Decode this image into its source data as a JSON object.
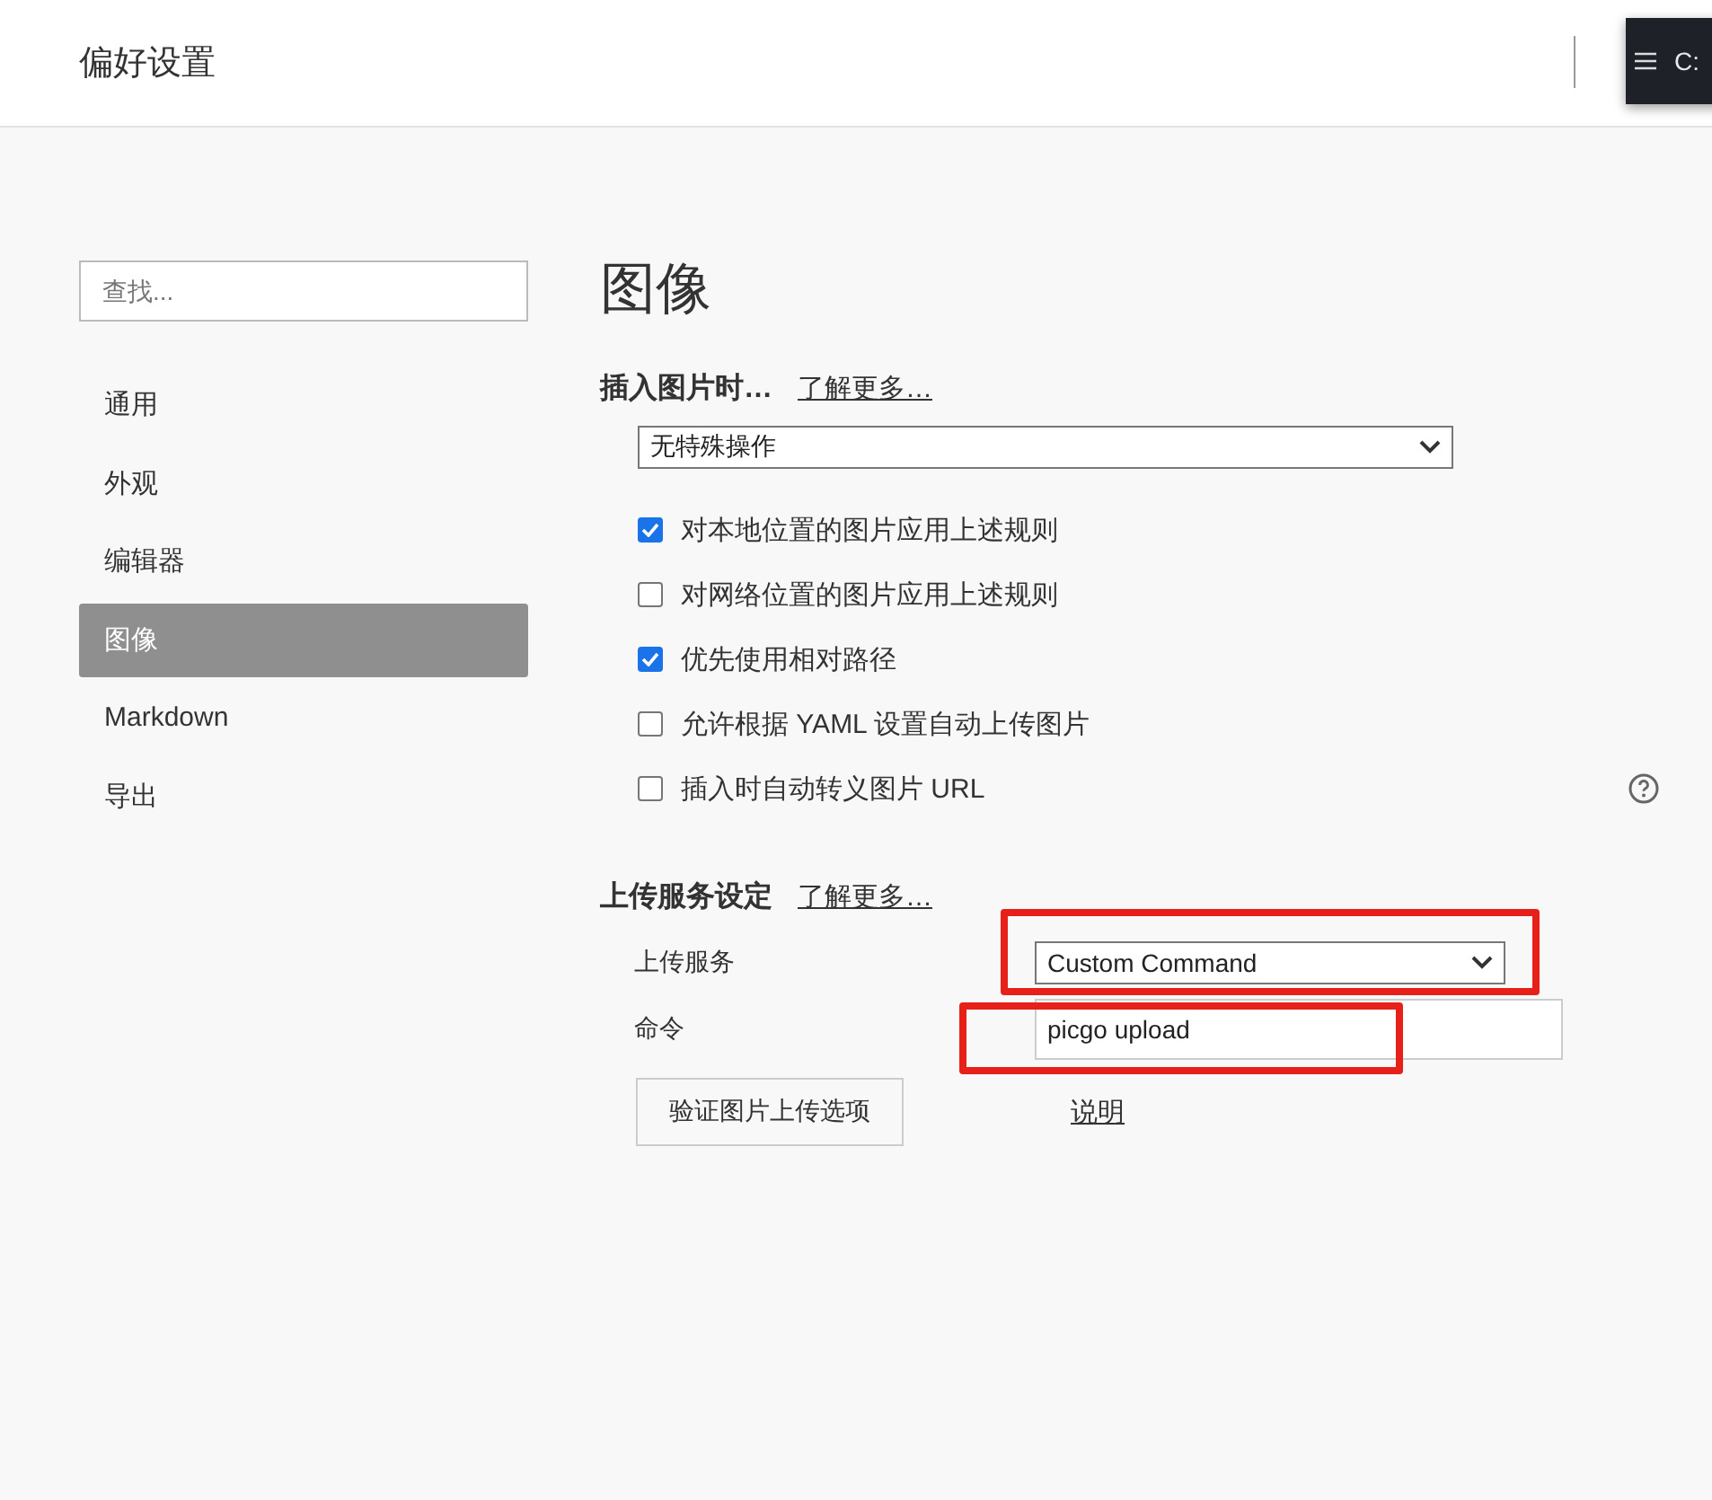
{
  "window": {
    "title": "偏好设置"
  },
  "terminal_tab": {
    "label": "C:"
  },
  "sidebar": {
    "search": {
      "placeholder": "查找..."
    },
    "items": [
      {
        "label": "通用",
        "selected": false
      },
      {
        "label": "外观",
        "selected": false
      },
      {
        "label": "编辑器",
        "selected": false
      },
      {
        "label": "图像",
        "selected": true
      },
      {
        "label": "Markdown",
        "selected": false
      },
      {
        "label": "导出",
        "selected": false
      }
    ]
  },
  "page": {
    "title": "图像",
    "insert_section": {
      "heading": "插入图片时…",
      "link": "了解更多…",
      "select": {
        "value": "无特殊操作"
      },
      "options": [
        {
          "label": "对本地位置的图片应用上述规则",
          "checked": true
        },
        {
          "label": "对网络位置的图片应用上述规则",
          "checked": false
        },
        {
          "label": "优先使用相对路径",
          "checked": true
        },
        {
          "label": "允许根据 YAML 设置自动上传图片",
          "checked": false
        },
        {
          "label": "插入时自动转义图片 URL",
          "checked": false,
          "help": true
        }
      ]
    },
    "upload_section": {
      "heading": "上传服务设定",
      "link": "了解更多…",
      "fields": [
        {
          "label": "上传服务",
          "kind": "select",
          "value": "Custom Command",
          "highlighted": true
        },
        {
          "label": "命令",
          "kind": "input",
          "value": "picgo upload",
          "highlighted": true
        }
      ],
      "button": "验证图片上传选项",
      "help_link": "说明"
    }
  }
}
